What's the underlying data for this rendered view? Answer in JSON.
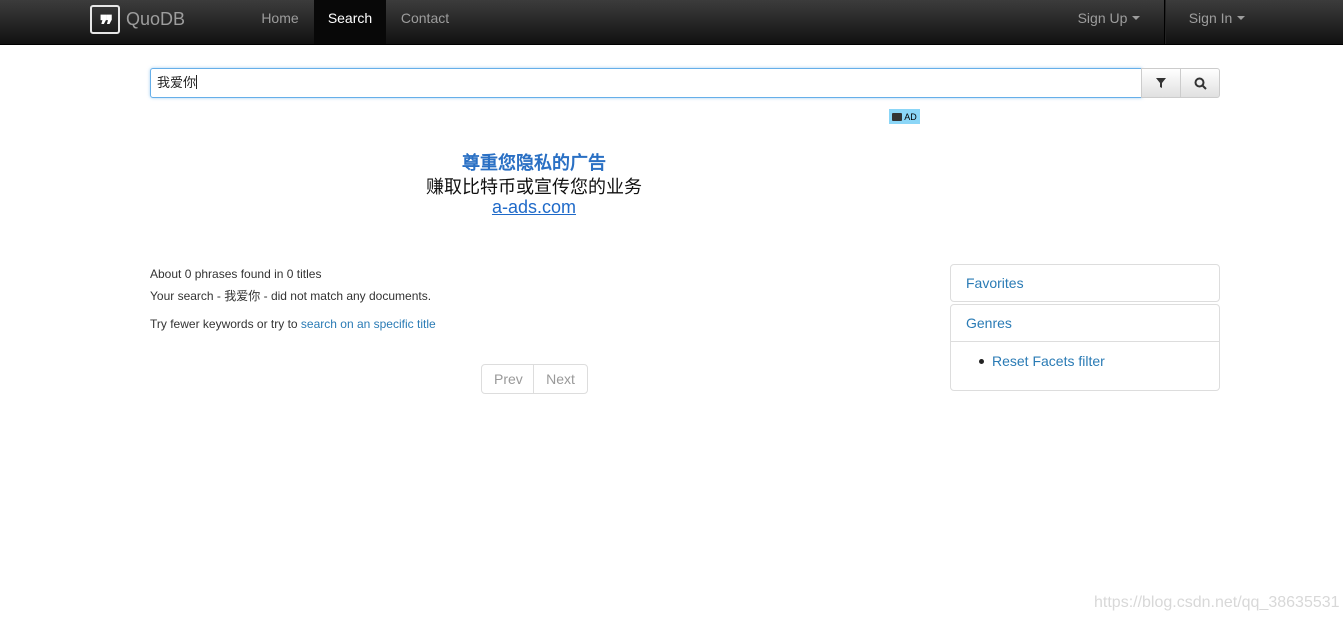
{
  "navbar": {
    "brand": "QuoDB",
    "home": "Home",
    "search": "Search",
    "contact": "Contact",
    "sign_up": "Sign Up",
    "sign_in": "Sign In"
  },
  "search": {
    "value": "我爱你"
  },
  "ad": {
    "badge": "AD",
    "line1": "尊重您隐私的广告",
    "line2": "赚取比特币或宣传您的业务",
    "line3": "a-ads.com"
  },
  "results": {
    "summary": "About 0 phrases found in 0 titles",
    "no_match_prefix": "Your search - ",
    "query": "我爱你",
    "no_match_suffix": " - did not match any documents.",
    "suggestion_prefix": "Try fewer keywords or try to ",
    "suggestion_link": "search on an specific title"
  },
  "pager": {
    "prev": "Prev",
    "next": "Next"
  },
  "sidebar": {
    "favorites": "Favorites",
    "genres": "Genres",
    "reset_facets": "Reset Facets filter"
  },
  "watermark": "https://blog.csdn.net/qq_38635531",
  "colors": {
    "navbar": "#222222",
    "link": "#2a7bb5",
    "ad_title": "#2a70c4"
  }
}
